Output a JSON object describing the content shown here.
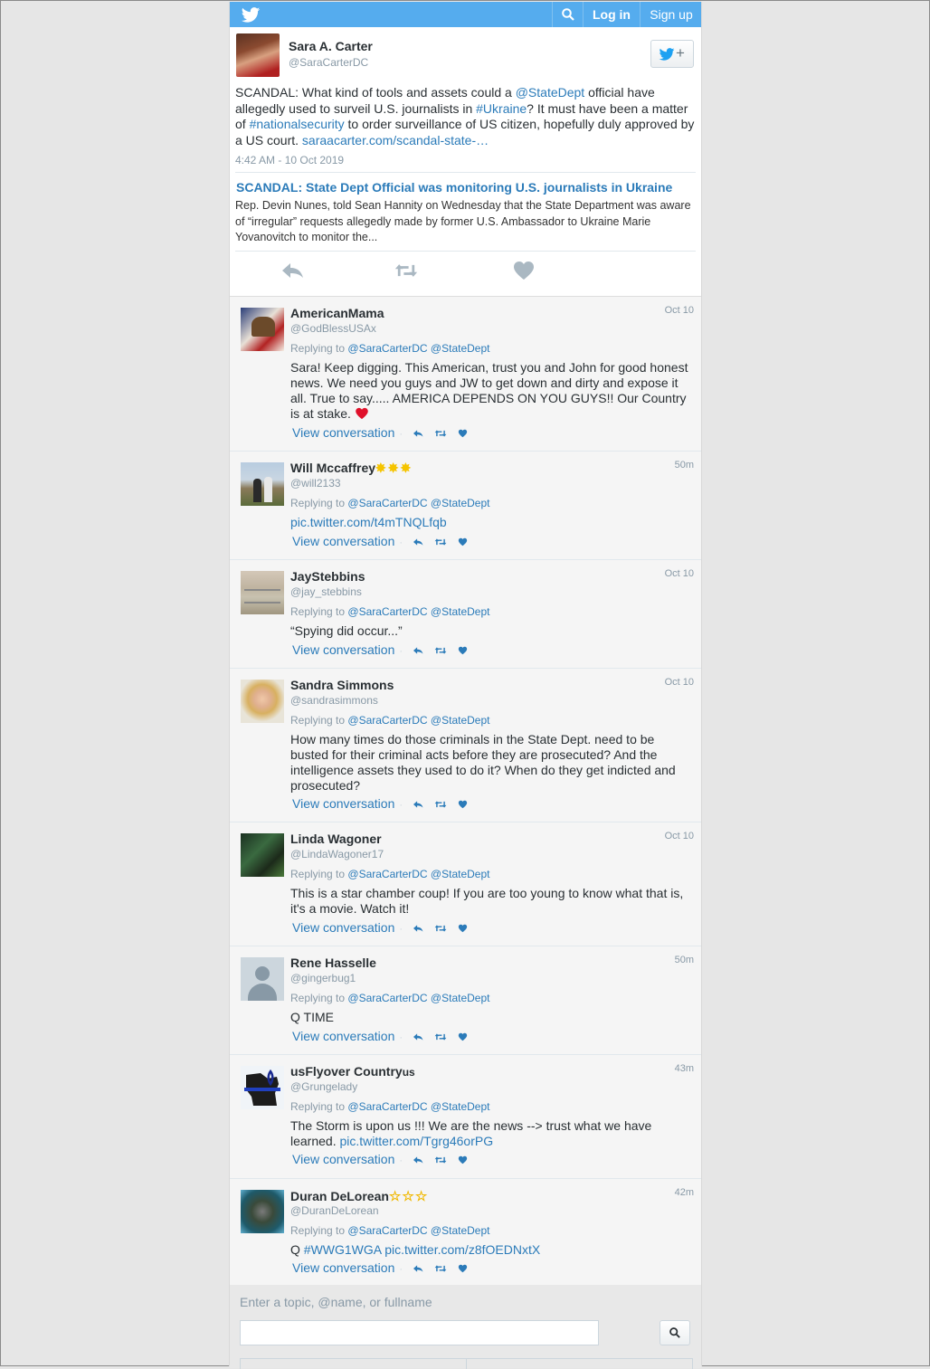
{
  "topbar": {
    "login": "Log in",
    "signup": "Sign up"
  },
  "main_tweet": {
    "name": "Sara A. Carter",
    "handle": "@SaraCarterDC",
    "text_parts": {
      "p1": "SCANDAL: What kind of tools and assets could a ",
      "m1": "@StateDept",
      "p2": " official have allegedly used to surveil U.S. journalists in ",
      "h1": "#Ukraine",
      "p3": "? It must have been a matter of ",
      "h2": "#nationalsecurity",
      "p4": " to order surveillance of US citizen, hopefully duly approved by a US court. ",
      "link": "saraacarter.com/scandal-state-…"
    },
    "time": "4:42 AM - 10 Oct 2019",
    "card_title": "SCANDAL: State Dept Official was monitoring U.S. journalists in Ukraine",
    "card_desc": "Rep. Devin Nunes, told Sean Hannity on Wednesday that the State Department was aware of “irregular” requests allegedly made by former U.S. Ambassador to Ukraine Marie Yovanovitch to monitor the..."
  },
  "replies": [
    {
      "name": "AmericanMama",
      "handle": "@GodBlessUSAx",
      "time": "Oct 10",
      "replying_label": "Replying to",
      "replying_to": "@SaraCarterDC @StateDept",
      "text": "Sara! Keep digging. This American, trust you and John for good honest news. We need you guys and JW to get down and dirty and expose it all. True to say..... AMERICA DEPENDS ON YOU GUYS!! Our Country is at stake. ",
      "view": "View conversation"
    },
    {
      "name": "Will Mccaffrey",
      "handle": "@will2133",
      "time": "50m",
      "replying_label": "Replying to",
      "replying_to": "@SaraCarterDC @StateDept",
      "link": "pic.twitter.com/t4mTNQLfqb",
      "view": "View conversation"
    },
    {
      "name": "JayStebbins",
      "handle": "@jay_stebbins",
      "time": "Oct 10",
      "replying_label": "Replying to",
      "replying_to": "@SaraCarterDC @StateDept",
      "text": "“Spying did occur...”",
      "view": "View conversation"
    },
    {
      "name": "Sandra Simmons",
      "handle": "@sandrasimmons",
      "time": "Oct 10",
      "replying_label": "Replying to",
      "replying_to": "@SaraCarterDC @StateDept",
      "text": "How many times do those criminals in the State Dept. need to be busted for their criminal acts before they are prosecuted? And the intelligence assets they used to do it? When do they get indicted and prosecuted?",
      "view": "View conversation"
    },
    {
      "name": "Linda Wagoner",
      "handle": "@LindaWagoner17",
      "time": "Oct 10",
      "replying_label": "Replying to",
      "replying_to": "@SaraCarterDC @StateDept",
      "text": "This is a star chamber coup! If you are too young to know what that is, it's a movie. Watch it!",
      "view": "View conversation"
    },
    {
      "name": "Rene Hasselle",
      "handle": "@gingerbug1",
      "time": "50m",
      "replying_label": "Replying to",
      "replying_to": "@SaraCarterDC @StateDept",
      "text": "Q TIME",
      "view": "View conversation"
    },
    {
      "name_prefix": "us",
      "name": "Flyover Country",
      "name_suffix": "us",
      "handle": "@Grungelady",
      "time": "43m",
      "replying_label": "Replying to",
      "replying_to": "@SaraCarterDC @StateDept",
      "text": "The Storm is upon us !!! We are the news --> trust what we have learned. ",
      "link": "pic.twitter.com/Tgrg46orPG",
      "view": "View conversation"
    },
    {
      "name": "Duran DeLorean",
      "handle": "@DuranDeLorean",
      "time": "42m",
      "replying_label": "Replying to",
      "replying_to": "@SaraCarterDC @StateDept",
      "text": "Q ",
      "hashtag": "#WWG1WGA",
      "link": "pic.twitter.com/z8fOEDNxtX",
      "view": "View conversation"
    }
  ],
  "search": {
    "placeholder": "Enter a topic, @name, or fullname"
  },
  "colors": {
    "brand": "#55acee",
    "link": "#2b7bb9",
    "muted": "#8899a6"
  }
}
